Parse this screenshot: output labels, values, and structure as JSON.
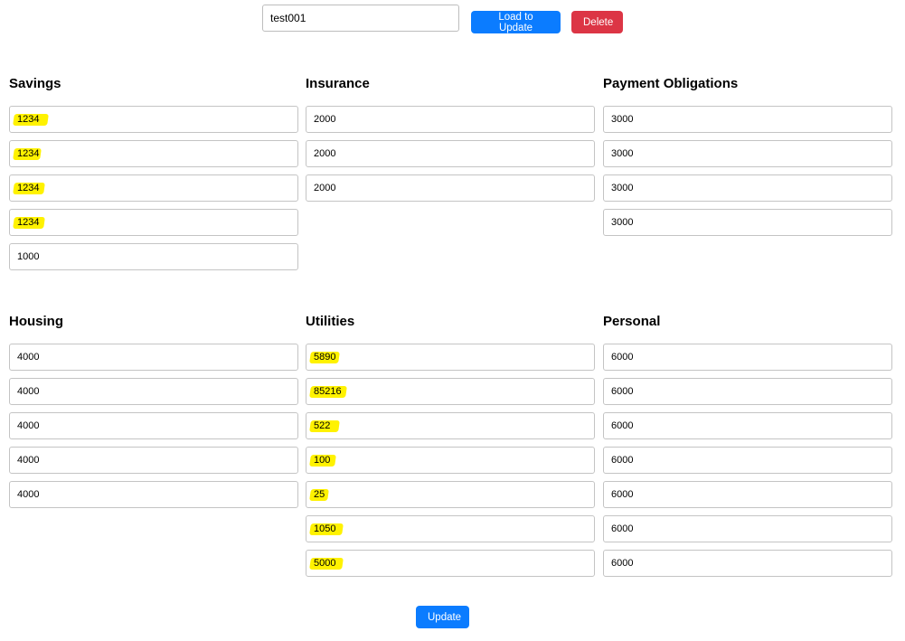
{
  "search": {
    "value": "test001"
  },
  "buttons": {
    "load": "Load to Update",
    "delete": "Delete",
    "update": "Update"
  },
  "colors": {
    "primary": "#0b7cff",
    "danger": "#dc3545",
    "highlight": "#fff200"
  },
  "sections": {
    "savings": {
      "title": "Savings",
      "values": [
        "1234",
        "1234",
        "1234",
        "1234",
        "1000"
      ]
    },
    "insurance": {
      "title": "Insurance",
      "values": [
        "2000",
        "2000",
        "2000"
      ]
    },
    "payment": {
      "title": "Payment Obligations",
      "values": [
        "3000",
        "3000",
        "3000",
        "3000"
      ]
    },
    "housing": {
      "title": "Housing",
      "values": [
        "4000",
        "4000",
        "4000",
        "4000",
        "4000"
      ]
    },
    "utilities": {
      "title": "Utilities",
      "values": [
        "5890",
        "85216",
        "522",
        "100",
        "25",
        "1050",
        "5000"
      ]
    },
    "personal": {
      "title": "Personal",
      "values": [
        "6000",
        "6000",
        "6000",
        "6000",
        "6000",
        "6000",
        "6000"
      ]
    }
  }
}
